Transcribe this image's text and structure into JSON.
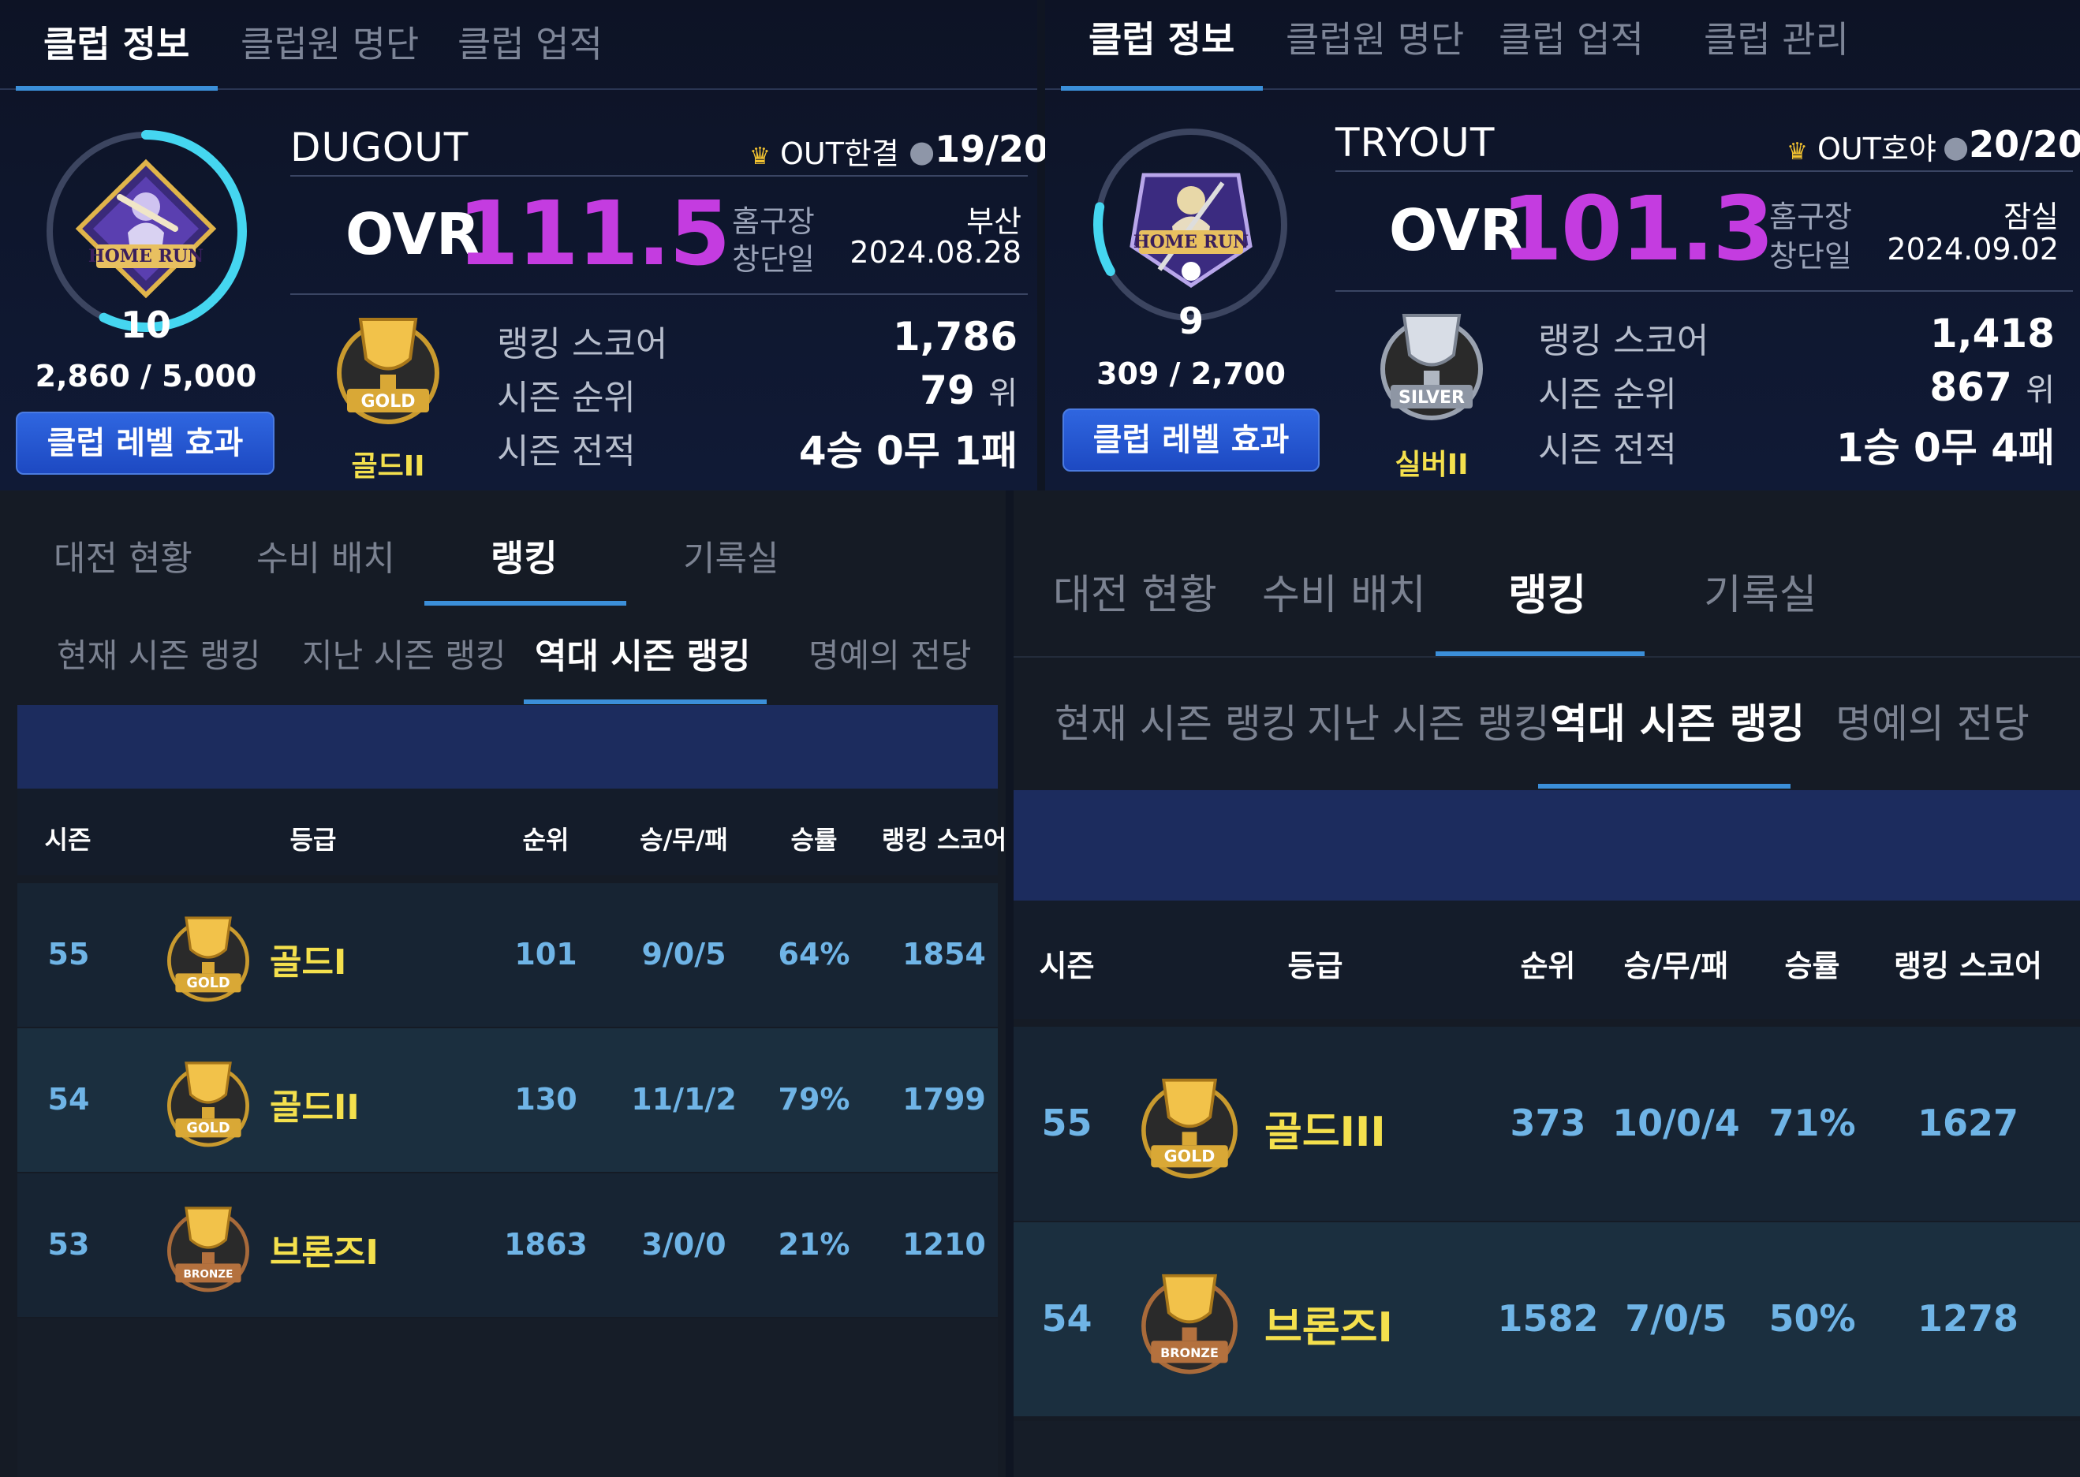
{
  "colors": {
    "accent": "#3b8fd9",
    "ovr": "#c43ce0",
    "tier_text": "#f4e04d",
    "cell_text": "#6fb4e6"
  },
  "left": {
    "top_tabs": [
      "클럽 정보",
      "클럽원 명단",
      "클럽 업적"
    ],
    "emblem_text": "HOME RUN",
    "level": "10",
    "exp": "2,860 / 5,000",
    "exp_fraction": 0.572,
    "level_button": "클럽 레벨 효과",
    "club_name": "DUGOUT",
    "owner": "OUT한결",
    "members": "19/20",
    "ovr_label": "OVR",
    "ovr_value": "111.5",
    "home_label": "홈구장",
    "home_value": "부산",
    "founded_label": "창단일",
    "founded_value": "2024.08.28",
    "tier_badge_text": "GOLD",
    "tier_label": "골드II",
    "score_label": "랭킹 스코어",
    "score_value": "1,786",
    "rank_label": "시즌 순위",
    "rank_value": "79",
    "rank_unit": "위",
    "record_label": "시즌 전적",
    "record_value": "4승 0무 1패",
    "bottom_tabs": [
      "대전 현황",
      "수비 배치",
      "랭킹",
      "기록실"
    ],
    "sub_tabs": [
      "현재 시즌 랭킹",
      "지난 시즌 랭킹",
      "역대 시즌 랭킹",
      "명예의 전당"
    ],
    "columns": [
      "시즌",
      "등급",
      "순위",
      "승/무/패",
      "승률",
      "랭킹 스코어"
    ],
    "rows": [
      {
        "season": "55",
        "badge": "GOLD",
        "tier": "골드I",
        "rank": "101",
        "record": "9/0/5",
        "rate": "64%",
        "score": "1854"
      },
      {
        "season": "54",
        "badge": "GOLD",
        "tier": "골드II",
        "rank": "130",
        "record": "11/1/2",
        "rate": "79%",
        "score": "1799"
      },
      {
        "season": "53",
        "badge": "BRONZE",
        "tier": "브론즈I",
        "rank": "1863",
        "record": "3/0/0",
        "rate": "21%",
        "score": "1210"
      }
    ]
  },
  "right": {
    "top_tabs": [
      "클럽 정보",
      "클럽원 명단",
      "클럽 업적",
      "클럽 관리"
    ],
    "emblem_text": "HOME RUN",
    "level": "9",
    "exp": "309 / 2,700",
    "exp_fraction": 0.114,
    "level_button": "클럽 레벨 효과",
    "club_name": "TRYOUT",
    "owner": "OUT호야",
    "members": "20/20",
    "ovr_label": "OVR",
    "ovr_value": "101.3",
    "home_label": "홈구장",
    "home_value": "잠실",
    "founded_label": "창단일",
    "founded_value": "2024.09.02",
    "tier_badge_text": "SILVER",
    "tier_label": "실버II",
    "score_label": "랭킹 스코어",
    "score_value": "1,418",
    "rank_label": "시즌 순위",
    "rank_value": "867",
    "rank_unit": "위",
    "record_label": "시즌 전적",
    "record_value": "1승 0무 4패",
    "bottom_tabs": [
      "대전 현황",
      "수비 배치",
      "랭킹",
      "기록실"
    ],
    "sub_tabs": [
      "현재 시즌 랭킹",
      "지난 시즌 랭킹",
      "역대 시즌 랭킹",
      "명예의 전당"
    ],
    "columns": [
      "시즌",
      "등급",
      "순위",
      "승/무/패",
      "승률",
      "랭킹 스코어"
    ],
    "rows": [
      {
        "season": "55",
        "badge": "GOLD",
        "tier": "골드III",
        "rank": "373",
        "record": "10/0/4",
        "rate": "71%",
        "score": "1627"
      },
      {
        "season": "54",
        "badge": "BRONZE",
        "tier": "브론즈I",
        "rank": "1582",
        "record": "7/0/5",
        "rate": "50%",
        "score": "1278"
      }
    ]
  }
}
